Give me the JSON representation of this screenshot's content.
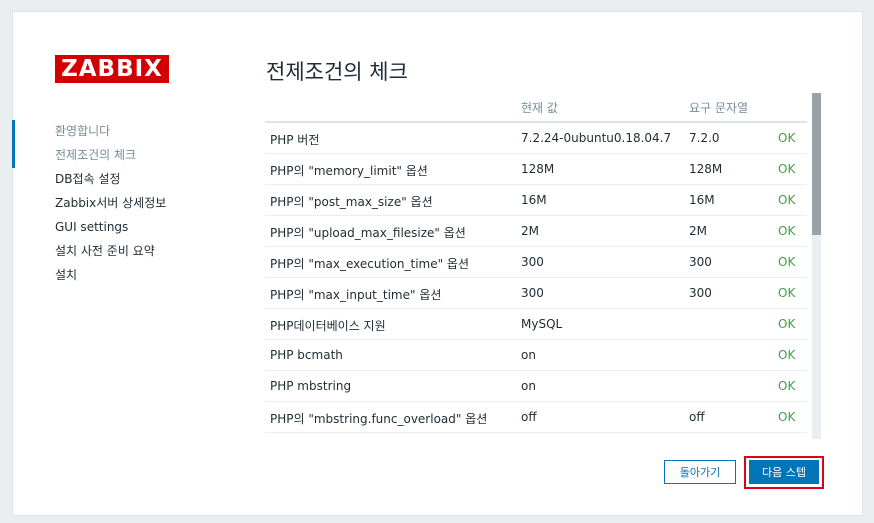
{
  "logo": "ZABBIX",
  "steps": [
    {
      "label": "환영합니다",
      "state": "done"
    },
    {
      "label": "전제조건의 체크",
      "state": "current"
    },
    {
      "label": "DB접속 설정",
      "state": "todo"
    },
    {
      "label": "Zabbix서버 상세정보",
      "state": "todo"
    },
    {
      "label": "GUI settings",
      "state": "todo"
    },
    {
      "label": "설치 사전 준비 요약",
      "state": "todo"
    },
    {
      "label": "설치",
      "state": "todo"
    }
  ],
  "page_title": "전제조건의 체크",
  "table": {
    "headers": [
      "",
      "현재 값",
      "요구 문자열",
      ""
    ],
    "rows": [
      [
        "PHP 버전",
        "7.2.24-0ubuntu0.18.04.7",
        "7.2.0",
        "OK"
      ],
      [
        "PHP의 \"memory_limit\" 옵션",
        "128M",
        "128M",
        "OK"
      ],
      [
        "PHP의 \"post_max_size\" 옵션",
        "16M",
        "16M",
        "OK"
      ],
      [
        "PHP의 \"upload_max_filesize\" 옵션",
        "2M",
        "2M",
        "OK"
      ],
      [
        "PHP의 \"max_execution_time\" 옵션",
        "300",
        "300",
        "OK"
      ],
      [
        "PHP의 \"max_input_time\" 옵션",
        "300",
        "300",
        "OK"
      ],
      [
        "PHP데이터베이스 지원",
        "MySQL",
        "",
        "OK"
      ],
      [
        "PHP bcmath",
        "on",
        "",
        "OK"
      ],
      [
        "PHP mbstring",
        "on",
        "",
        "OK"
      ],
      [
        "PHP의 \"mbstring.func_overload\" 옵션",
        "off",
        "off",
        "OK"
      ]
    ]
  },
  "buttons": {
    "back": "돌아가기",
    "next": "다음 스텝"
  },
  "colors": {
    "brand": "#d40000",
    "accent": "#0275b8",
    "ok": "#429e47",
    "highlight": "#e0001b"
  }
}
